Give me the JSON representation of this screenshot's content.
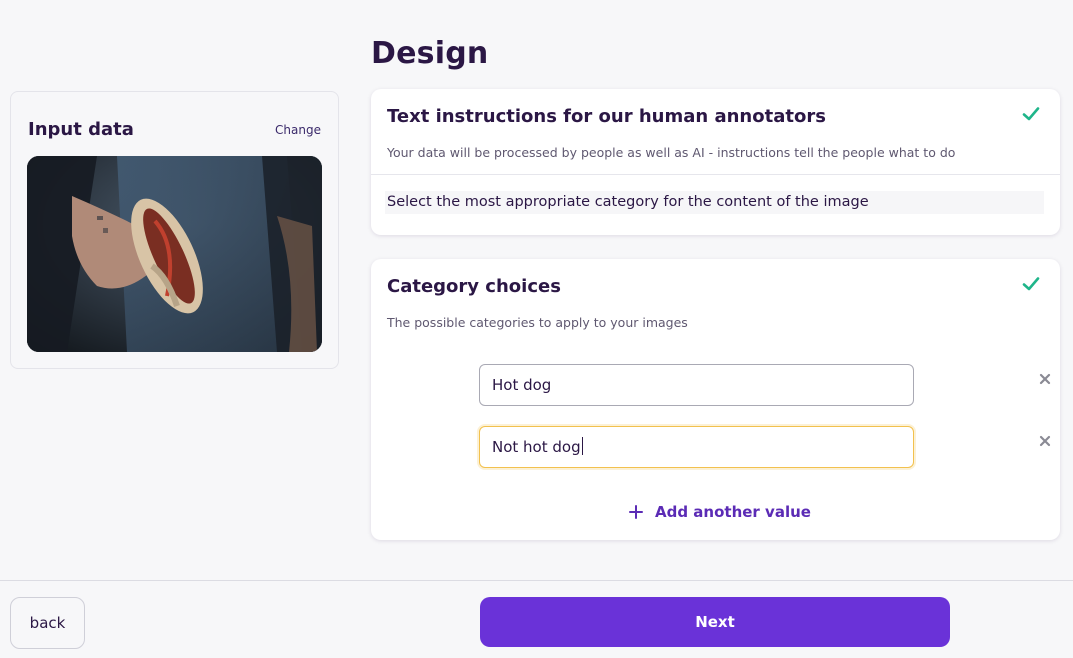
{
  "page": {
    "title": "Design"
  },
  "input_data": {
    "title": "Input data",
    "change_label": "Change",
    "image_icon": "hot-dog-photo"
  },
  "instructions_card": {
    "title": "Text instructions for our human annotators",
    "subtitle": "Your data will be processed by people as well as AI - instructions tell the people what to do",
    "value": "Select the most appropriate category for the content of the image",
    "status_icon": "check-icon"
  },
  "categories_card": {
    "title": "Category choices",
    "subtitle": "The possible categories to apply to your images",
    "status_icon": "check-icon",
    "choices": [
      {
        "value": "Hot dog"
      },
      {
        "value": "Not hot dog"
      }
    ],
    "add_label": "Add another value"
  },
  "footer": {
    "back_label": "back",
    "next_label": "Next"
  },
  "colors": {
    "accent": "#6a32d8",
    "check": "#1fb58a",
    "focus_border": "#f2c14e",
    "text_dark": "#2b1745"
  }
}
